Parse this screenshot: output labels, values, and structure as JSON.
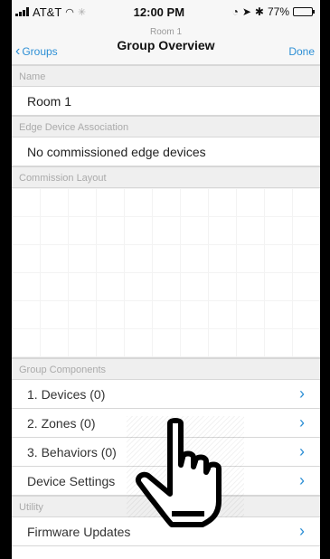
{
  "status": {
    "carrier": "AT&T",
    "time": "12:00 PM",
    "battery": "77%",
    "battery_level": 0.77
  },
  "nav": {
    "back_label": "Groups",
    "subtitle": "Room 1",
    "title": "Group Overview",
    "done_label": "Done"
  },
  "sections": {
    "name_header": "Name",
    "name_value": "Room 1",
    "edge_header": "Edge Device Association",
    "edge_value": "No commissioned edge devices",
    "layout_header": "Commission Layout",
    "components_header": "Group Components",
    "utility_header": "Utility"
  },
  "components": [
    {
      "label": "1. Devices (0)"
    },
    {
      "label": "2. Zones (0)"
    },
    {
      "label": "3. Behaviors (0)"
    },
    {
      "label": "Device Settings"
    }
  ],
  "utility": [
    {
      "label": "Firmware Updates"
    }
  ],
  "colors": {
    "accent": "#2d8fd5",
    "section_bg": "#efefef"
  }
}
